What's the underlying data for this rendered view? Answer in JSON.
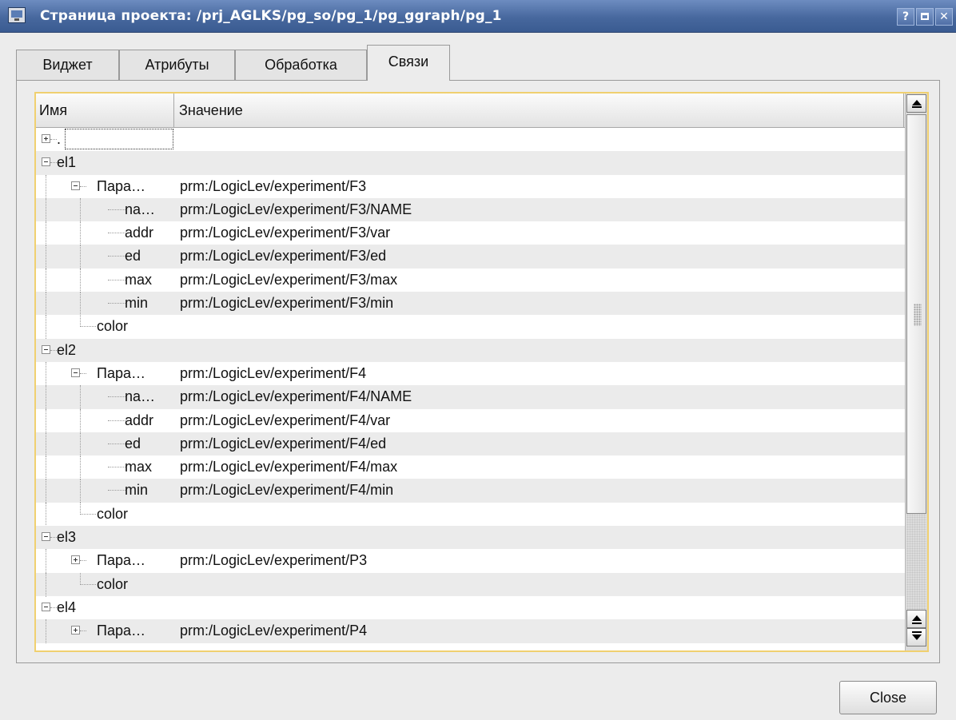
{
  "window": {
    "title": "Страница проекта: /prj_AGLKS/pg_so/pg_1/pg_ggraph/pg_1",
    "buttons": [
      "?",
      "□",
      "✕"
    ]
  },
  "tabs": [
    {
      "label": "Виджет",
      "active": false
    },
    {
      "label": "Атрибуты",
      "active": false
    },
    {
      "label": "Обработка",
      "active": false
    },
    {
      "label": "Связи",
      "active": true
    }
  ],
  "tree": {
    "columns": [
      "Имя",
      "Значение"
    ],
    "rows": [
      {
        "name": ".",
        "value": "",
        "level": 0,
        "expander": "plus",
        "alt": false
      },
      {
        "name": "el1",
        "value": "",
        "level": 0,
        "expander": "minus",
        "alt": true
      },
      {
        "name": "Пара…",
        "value": "prm:/LogicLev/experiment/F3",
        "level": 1,
        "expander": "minus",
        "alt": false
      },
      {
        "name": "na…",
        "value": "prm:/LogicLev/experiment/F3/NAME",
        "level": 2,
        "expander": null,
        "alt": true
      },
      {
        "name": "addr",
        "value": "prm:/LogicLev/experiment/F3/var",
        "level": 2,
        "expander": null,
        "alt": false
      },
      {
        "name": "ed",
        "value": "prm:/LogicLev/experiment/F3/ed",
        "level": 2,
        "expander": null,
        "alt": true
      },
      {
        "name": "max",
        "value": "prm:/LogicLev/experiment/F3/max",
        "level": 2,
        "expander": null,
        "alt": false
      },
      {
        "name": "min",
        "value": "prm:/LogicLev/experiment/F3/min",
        "level": 2,
        "expander": null,
        "alt": true
      },
      {
        "name": "color",
        "value": "",
        "level": 1,
        "expander": null,
        "alt": false
      },
      {
        "name": "el2",
        "value": "",
        "level": 0,
        "expander": "minus",
        "alt": true
      },
      {
        "name": "Пара…",
        "value": "prm:/LogicLev/experiment/F4",
        "level": 1,
        "expander": "minus",
        "alt": false
      },
      {
        "name": "na…",
        "value": "prm:/LogicLev/experiment/F4/NAME",
        "level": 2,
        "expander": null,
        "alt": true
      },
      {
        "name": "addr",
        "value": "prm:/LogicLev/experiment/F4/var",
        "level": 2,
        "expander": null,
        "alt": false
      },
      {
        "name": "ed",
        "value": "prm:/LogicLev/experiment/F4/ed",
        "level": 2,
        "expander": null,
        "alt": true
      },
      {
        "name": "max",
        "value": "prm:/LogicLev/experiment/F4/max",
        "level": 2,
        "expander": null,
        "alt": false
      },
      {
        "name": "min",
        "value": "prm:/LogicLev/experiment/F4/min",
        "level": 2,
        "expander": null,
        "alt": true
      },
      {
        "name": "color",
        "value": "",
        "level": 1,
        "expander": null,
        "alt": false
      },
      {
        "name": "el3",
        "value": "",
        "level": 0,
        "expander": "minus",
        "alt": true
      },
      {
        "name": "Пара…",
        "value": "prm:/LogicLev/experiment/P3",
        "level": 1,
        "expander": "plus",
        "alt": false
      },
      {
        "name": "color",
        "value": "",
        "level": 1,
        "expander": null,
        "alt": true
      },
      {
        "name": "el4",
        "value": "",
        "level": 0,
        "expander": "minus",
        "alt": false
      },
      {
        "name": "Пара…",
        "value": "prm:/LogicLev/experiment/P4",
        "level": 1,
        "expander": "plus",
        "alt": true
      }
    ]
  },
  "footer": {
    "close_label": "Close"
  },
  "colors": {
    "titlebar": "#47689e",
    "focus_frame": "#f0d070",
    "alt_row": "#ebebeb"
  }
}
